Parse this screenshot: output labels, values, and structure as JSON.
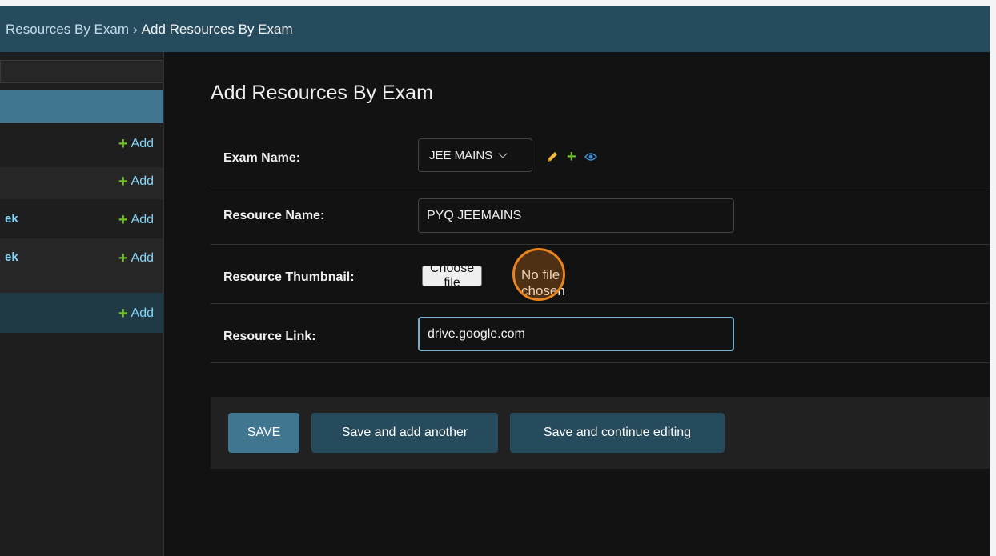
{
  "breadcrumbs": {
    "parent": "Resources By Exam",
    "separator": "›",
    "current": "Add Resources By Exam"
  },
  "sidebar": {
    "add_label": "Add",
    "rows": [
      {
        "label": ""
      },
      {
        "label": ""
      },
      {
        "label": "ek"
      },
      {
        "label": "ek"
      },
      {
        "label": ""
      }
    ]
  },
  "page_title": "Add Resources By Exam",
  "form": {
    "exam_name": {
      "label": "Exam Name:",
      "value": "JEE MAINS"
    },
    "resource_name": {
      "label": "Resource Name:",
      "value": "PYQ JEEMAINS"
    },
    "resource_thumbnail": {
      "label": "Resource Thumbnail:",
      "button": "Choose file",
      "status": "No file chosen"
    },
    "resource_link": {
      "label": "Resource Link:",
      "value": "drive.google.com"
    }
  },
  "buttons": {
    "save": "SAVE",
    "save_add_another": "Save and add another",
    "save_continue": "Save and continue editing"
  },
  "colors": {
    "header": "#264b5d",
    "primary": "#417690",
    "add_plus": "#70bf2b",
    "link": "#81d4fa",
    "pencil": "#f5b93c",
    "eye": "#3e8ed0",
    "cursor": "#e8831e"
  },
  "icons": {
    "edit": "pencil-icon",
    "add": "plus-icon",
    "view": "eye-icon"
  }
}
